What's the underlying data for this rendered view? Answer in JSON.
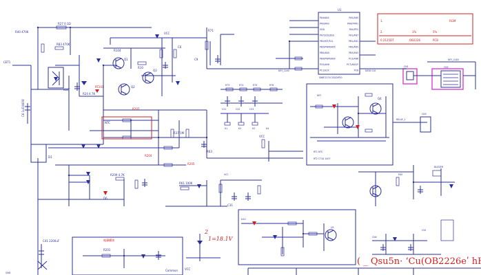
{
  "ic": {
    "ref": "U1",
    "pins_left": [
      "PA4/AN4",
      "PA0/AN0",
      "VDD",
      "PA7/SCK/SDS",
      "PB2/INT/SCL",
      "PB5/PWM/AN5",
      "PB0/AN0",
      "PB4/PWM/AN0",
      "PC0/AN6",
      "PC1/SCK"
    ],
    "pins_right": [
      "PA5/AN5",
      "PA6/TMR1",
      "PA4/PFG",
      "PA1/AN7",
      "PB1/AN1",
      "PB5/AN5",
      "PB3/AN3",
      "PC3/AN6",
      "PC7/AN2/Y",
      "PC6"
    ],
    "subtitle": "SN8F2271CSG/DIP20"
  },
  "title_block": {
    "row1_num": "1.",
    "row1_val": "RGM",
    "row2_num": "2.",
    "row2_v1": "1%",
    "row2_v2": "5%",
    "row3_code": "0.2125DT",
    "row3_cap": "OB2226",
    "row3_type": "PCB"
  },
  "labels": {
    "watermark": "( _ Qsu5n· ʻCu(OB2226eʹ hH)",
    "power_block": "电源模块",
    "zener_num": "2",
    "zener_volt": "1=18.1V",
    "vcc": "VCC",
    "gnd": "GND",
    "key_label": "KEY_CLK0",
    "relay_label": "RELAY_1",
    "buzzer": "BUZZER",
    "inner_box_a": "RT1  NTC",
    "inner_box_b": "RT2  CT1A  100T",
    "ntc": "NTC",
    "r_red1": "R207",
    "r_red2": "R204",
    "r_red3": "R205",
    "igbt": "IGBT",
    "diode_bridge": "D1",
    "trans_q1": "Q1",
    "trans_q2": "Q2",
    "trans_q3": "Q3",
    "trans_q4": "Q4",
    "r_top": "R27 0.1Ω",
    "c_top": "C2 10uF",
    "r_d": "R83 470K",
    "r_d2": "R24 4.7K",
    "r_e": "R37 1M",
    "connector1": "CN1",
    "connector2": "CN2",
    "r_row": [
      "R73",
      "R74",
      "R75",
      "R76"
    ],
    "c_row": [
      "C21",
      "C22",
      "C23",
      "C24"
    ],
    "key_row": [
      "K1",
      "K2",
      "K3",
      "K4"
    ]
  }
}
